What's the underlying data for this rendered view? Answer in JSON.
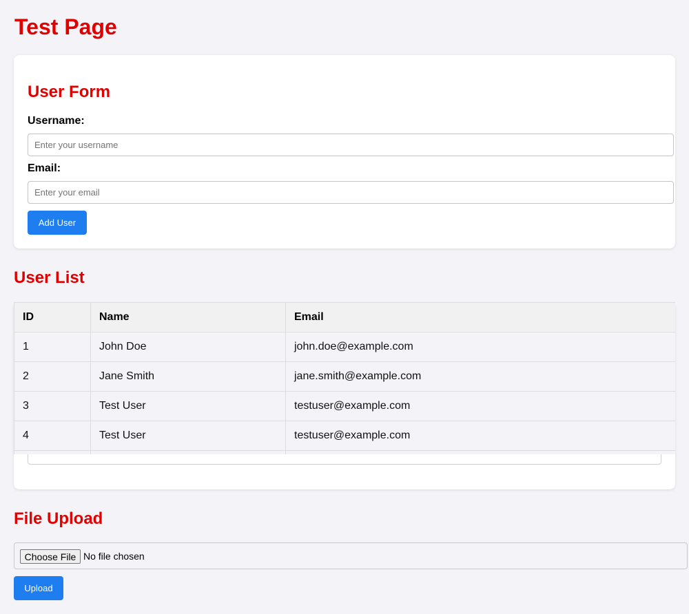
{
  "page": {
    "title": "Test Page"
  },
  "user_form": {
    "title": "User Form",
    "username_label": "Username:",
    "username_placeholder": "Enter your username",
    "username_value": "",
    "email_label": "Email:",
    "email_placeholder": "Enter your email",
    "email_value": "",
    "submit_label": "Add User"
  },
  "user_list": {
    "title": "User List",
    "columns": [
      "ID",
      "Name",
      "Email"
    ],
    "rows": [
      [
        "1",
        "John Doe",
        "john.doe@example.com"
      ],
      [
        "2",
        "Jane Smith",
        "jane.smith@example.com"
      ],
      [
        "3",
        "Test User",
        "testuser@example.com"
      ],
      [
        "4",
        "Test User",
        "testuser@example.com"
      ]
    ]
  },
  "file_upload": {
    "title": "File Upload",
    "choose_label": "Choose File",
    "status_text": "No file chosen",
    "upload_label": "Upload"
  },
  "colors": {
    "heading": "#e00000",
    "accent": "#1e7ef0",
    "background": "#f4f4f8"
  }
}
